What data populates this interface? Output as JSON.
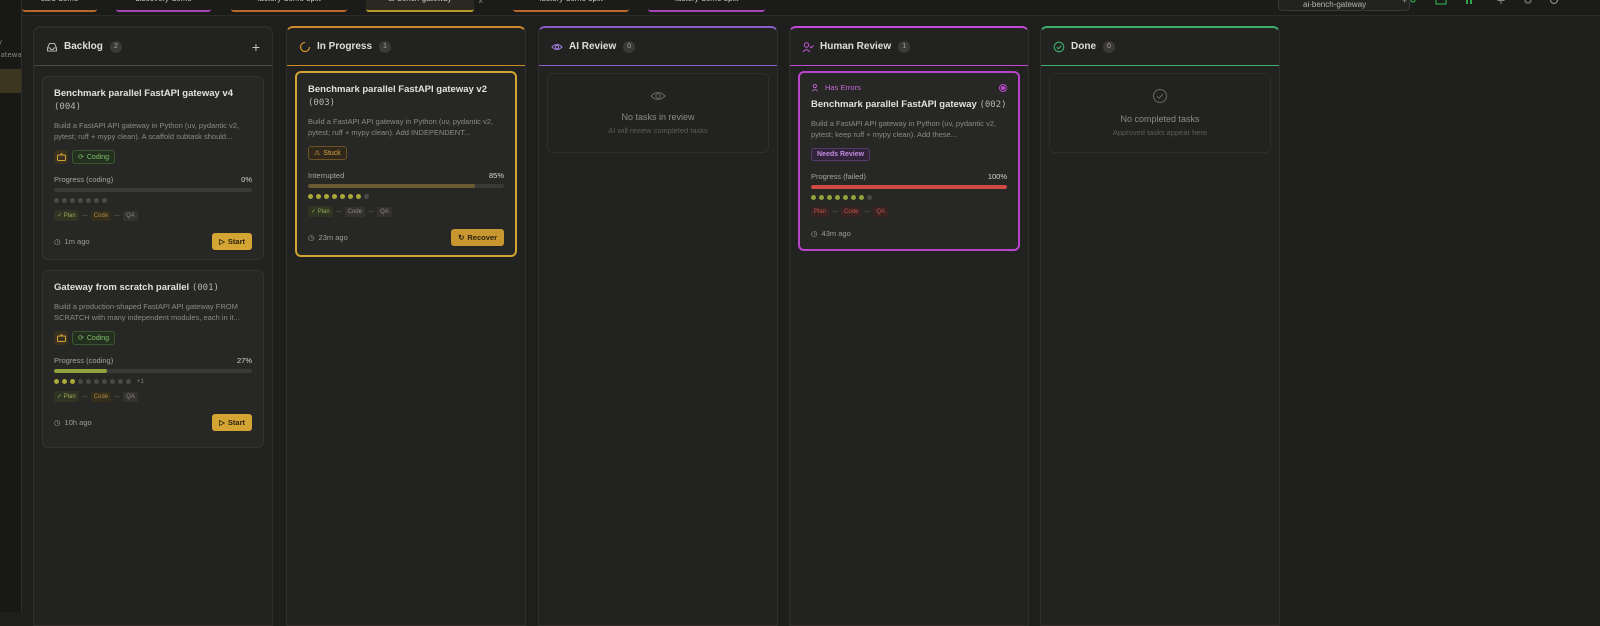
{
  "sidebar": {
    "stub_a": "y",
    "stub_b": "gateway"
  },
  "tabs": [
    {
      "label": "cars-demo",
      "color": "#b8692a"
    },
    {
      "label": "discovery-demo",
      "color": "#a445b8"
    },
    {
      "label": "factory-demo-split",
      "color": "#b8692a"
    },
    {
      "label": "ai-bench-gateway",
      "color": "#b89a2a"
    },
    {
      "label": "factory-demo-split",
      "color": "#b8692a"
    },
    {
      "label": "factory-demo-split",
      "color": "#a445b8"
    }
  ],
  "topbar": {
    "search_value": "ai-bench-gateway"
  },
  "columns": {
    "backlog": {
      "title": "Backlog",
      "count": "2"
    },
    "in_progress": {
      "title": "In Progress",
      "count": "1"
    },
    "ai_review": {
      "title": "AI Review",
      "count": "0",
      "empty_title": "No tasks in review",
      "empty_sub": "AI will review completed tasks"
    },
    "human_review": {
      "title": "Human Review",
      "count": "1"
    },
    "done": {
      "title": "Done",
      "count": "0",
      "empty_title": "No completed tasks",
      "empty_sub": "Approved tasks appear here"
    }
  },
  "cards": {
    "b1": {
      "title": "Benchmark parallel FastAPI gateway v4",
      "id": "(004)",
      "desc": "Build a FastAPI API gateway in Python (uv, pydantic v2, pytest; ruff + mypy clean). A scaffold subtask should...",
      "status": "Coding",
      "progress_label": "Progress (coding)",
      "progress_pct": "0%",
      "progress": 0,
      "stages": [
        "Plan",
        "Code",
        "QA"
      ],
      "time": "1m ago",
      "action": "Start"
    },
    "b2": {
      "title": "Gateway from scratch parallel",
      "id": "(001)",
      "desc": "Build a production-shaped FastAPI API gateway FROM SCRATCH with many independent modules, each in it...",
      "status": "Coding",
      "progress_label": "Progress (coding)",
      "progress_pct": "27%",
      "progress": 27,
      "more": "+1",
      "stages": [
        "Plan",
        "Code",
        "QA"
      ],
      "time": "10h ago",
      "action": "Start"
    },
    "p1": {
      "title": "Benchmark parallel FastAPI gateway v2",
      "id": "(003)",
      "desc": "Build a FastAPI API gateway in Python (uv, pydantic v2, pytest; ruff + mypy clean). Add INDEPENDENT...",
      "status": "Stuck",
      "progress_label": "Interrupted",
      "progress_pct": "85%",
      "progress": 85,
      "stages": [
        "Plan",
        "Code",
        "QA"
      ],
      "time": "23m ago",
      "action": "Recover"
    },
    "h1": {
      "error": "Has Errors",
      "title": "Benchmark parallel FastAPI gateway",
      "id": "(002)",
      "desc": "Build a FastAPI API gateway in Python (uv, pydantic v2, pytest; keep ruff + mypy clean). Add these...",
      "status": "Needs Review",
      "progress_label": "Progress (failed)",
      "progress_pct": "100%",
      "progress": 100,
      "stages": [
        "Plan",
        "Code",
        "QA"
      ],
      "time": "43m ago"
    }
  },
  "colors": {
    "accent": "#d4a532",
    "backlog": "#4a4945",
    "in_progress": "#d08a2a",
    "ai_review": "#8a5cc8",
    "human_review": "#c04ad4",
    "done": "#3fae6a",
    "error": "#d24a44"
  }
}
